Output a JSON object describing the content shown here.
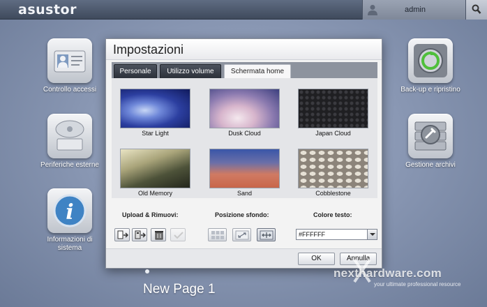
{
  "topbar": {
    "logo": "asustor",
    "user": "admin"
  },
  "desktop": {
    "left_apps": [
      {
        "label": "Controllo accessi",
        "icon": "access-control-icon"
      },
      {
        "label": "Periferiche esterne",
        "icon": "external-devices-icon"
      },
      {
        "label": "Informazioni di sistema",
        "icon": "system-info-icon"
      }
    ],
    "right_apps": [
      {
        "label": "Back-up e ripristino",
        "icon": "backup-restore-icon"
      },
      {
        "label": "Gestione archivi",
        "icon": "storage-manager-icon"
      }
    ],
    "page_name": "New Page 1"
  },
  "dialog": {
    "title": "Impostazioni",
    "tabs": [
      {
        "label": "Personale",
        "active": false
      },
      {
        "label": "Utilizzo volume",
        "active": false
      },
      {
        "label": "Schermata home",
        "active": true
      }
    ],
    "wallpapers": [
      {
        "label": "Star Light"
      },
      {
        "label": "Dusk Cloud"
      },
      {
        "label": "Japan Cloud"
      },
      {
        "label": "Old Memory"
      },
      {
        "label": "Sand"
      },
      {
        "label": "Cobblestone"
      }
    ],
    "upload_heading": "Upload & Rimuovi:",
    "position_heading": "Posizione sfondo:",
    "color_heading": "Colore testo:",
    "text_color_value": "#FFFFFF",
    "ok_label": "OK",
    "cancel_label": "Annulla"
  },
  "watermark": {
    "main": "nexthardware.com",
    "sub": "your ultimate professional resource"
  },
  "colors": {
    "topbar": "#4a5568",
    "dialog_bg": "#f3f3f3",
    "tab_dark": "#3a3f48"
  }
}
